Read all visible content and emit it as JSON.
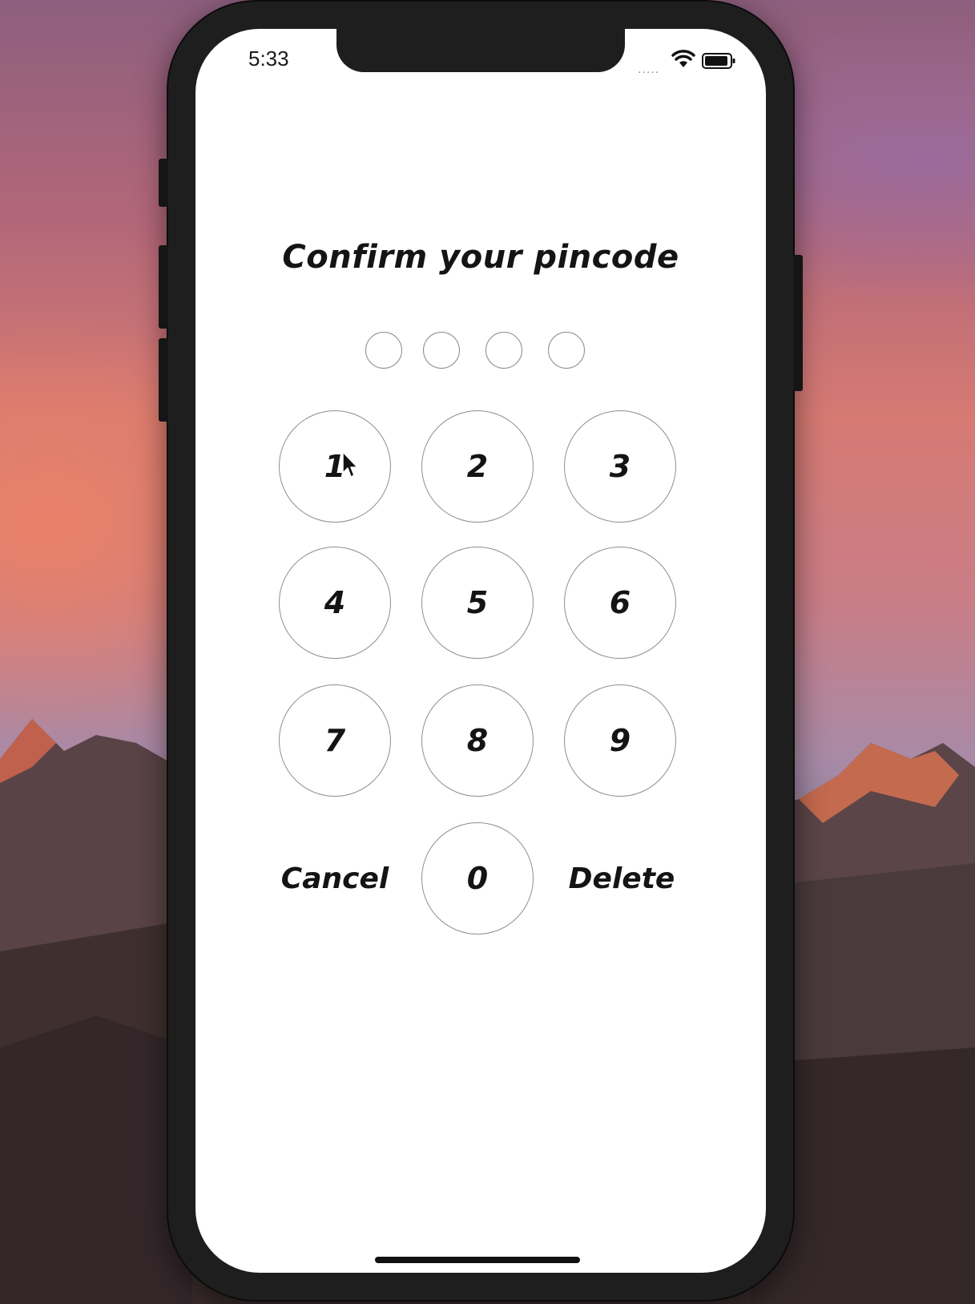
{
  "status_bar": {
    "time": "5:33",
    "signal": "....."
  },
  "screen": {
    "title": "Confirm your pincode"
  },
  "pin_dots": [
    {
      "filled": false
    },
    {
      "filled": false
    },
    {
      "filled": false
    },
    {
      "filled": false
    }
  ],
  "keypad": {
    "keys": [
      "1",
      "2",
      "3",
      "4",
      "5",
      "6",
      "7",
      "8",
      "9",
      "0"
    ],
    "cancel_label": "Cancel",
    "delete_label": "Delete"
  },
  "icons": {
    "wifi": "wifi-icon",
    "battery": "battery-icon",
    "cursor": "mouse-pointer-icon"
  }
}
